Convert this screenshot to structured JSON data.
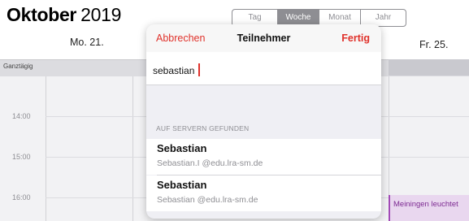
{
  "calendar": {
    "month": "Oktober",
    "year": "2019",
    "view_tabs": [
      "Tag",
      "Woche",
      "Monat",
      "Jahr"
    ],
    "active_view": "Woche",
    "day_left": "Mo. 21.",
    "day_right": "Fr. 25.",
    "allday_label": "Ganztägig",
    "times": [
      "14:00",
      "15:00",
      "16:00"
    ],
    "event": {
      "title": "Meiningen leuchtet",
      "color": "#a24ab7"
    }
  },
  "popover": {
    "cancel_label": "Abbrechen",
    "title": "Teilnehmer",
    "done_label": "Fertig",
    "search_value": "sebastian",
    "section_label": "AUF SERVERN GEFUNDEN",
    "results": [
      {
        "name": "Sebastian",
        "email": "Sebastian.I @edu.lra-sm.de"
      },
      {
        "name": "Sebastian",
        "email": "Sebastian @edu.lra-sm.de"
      }
    ],
    "accent_color": "#e0322b"
  }
}
